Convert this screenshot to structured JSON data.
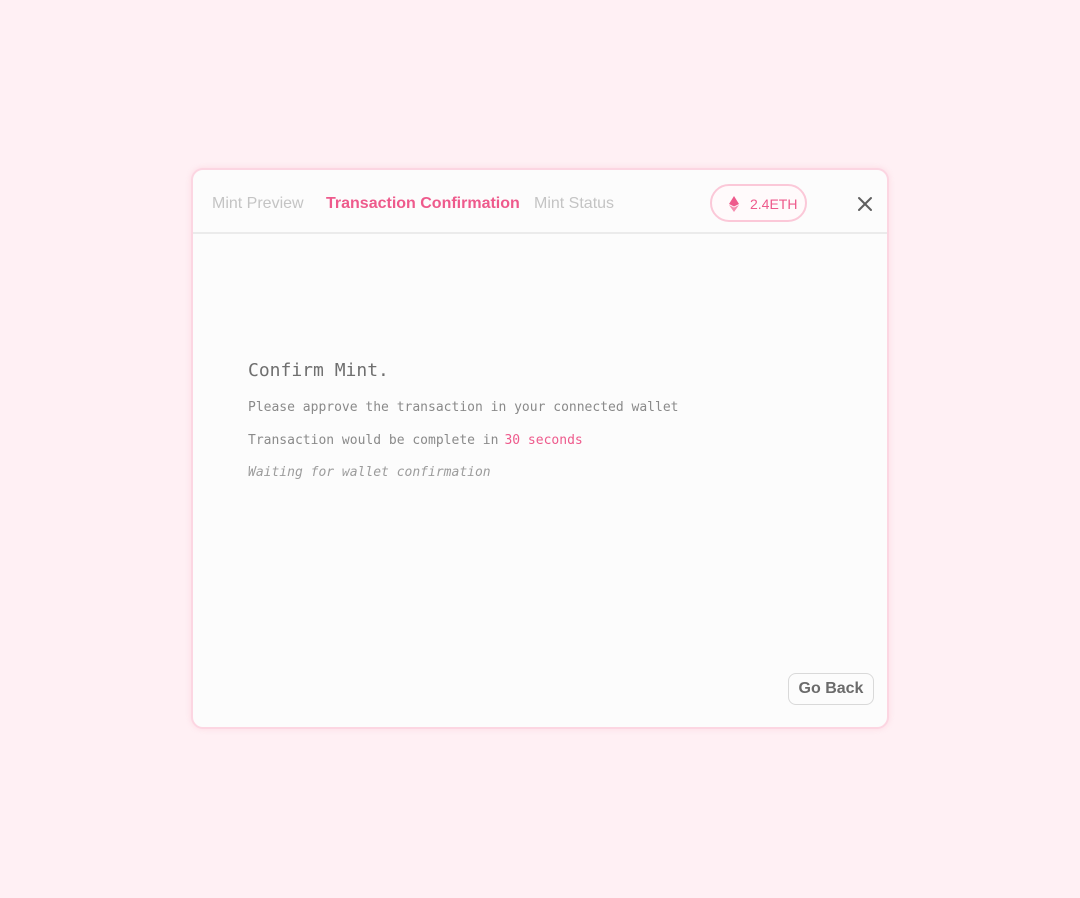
{
  "tabs": [
    {
      "label": "Mint Preview",
      "active": false
    },
    {
      "label": "Transaction Confirmation",
      "active": true
    },
    {
      "label": "Mint Status",
      "active": false
    }
  ],
  "balance": {
    "icon": "ethereum-icon",
    "value": "2.4ETH"
  },
  "close": {
    "icon": "close-icon"
  },
  "main": {
    "title": "Confirm Mint.",
    "approve_text": "Please approve the transaction in your connected wallet",
    "complete_prefix": "Transaction would be complete in",
    "complete_time": "30 seconds",
    "waiting_text": "Waiting for wallet confirmation"
  },
  "footer": {
    "go_back_label": "Go Back"
  },
  "colors": {
    "accent": "#ee5a8c",
    "background": "#fff0f4",
    "panel": "#fcfcfc"
  }
}
